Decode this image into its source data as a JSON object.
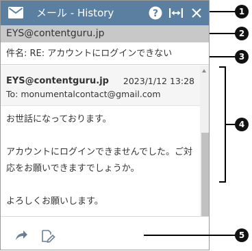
{
  "window": {
    "title": "メール - History",
    "icons": [
      "mail-icon",
      "help-icon",
      "expand-width-icon",
      "close-icon"
    ]
  },
  "sender": "EYS@contentguru.jp",
  "subject": "件名: RE: アカウントにログインできない",
  "message": {
    "from": "EYS@contentguru.jp",
    "date": "2023/1/12 13:28",
    "to": "To: monumentalcontact@gmail.com",
    "body": [
      "お世話になっております。",
      "",
      "アカウントにログインできませんでした。ご対応をお願いできますでしょうか。",
      "",
      "よろしくお願いします。"
    ]
  },
  "footer": {
    "icons": [
      "forward-icon",
      "edit-note-icon"
    ]
  },
  "callouts": [
    "1",
    "2",
    "3",
    "4",
    "5"
  ],
  "colors": {
    "titlebar": "#5b7fa1",
    "sender_bar": "#c8c8c8",
    "header_bg": "#f5f5f5",
    "badge": "#111111"
  }
}
